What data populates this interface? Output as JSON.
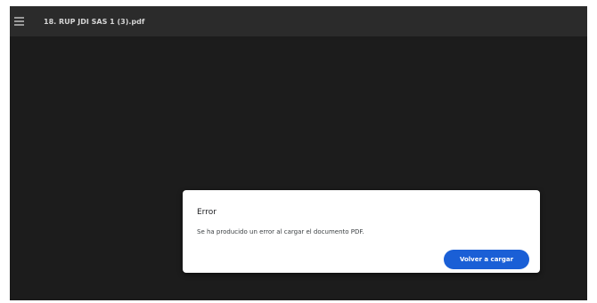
{
  "toolbar": {
    "menu_icon": "menu-icon",
    "title": "18. RUP JDI SAS 1 (3).pdf"
  },
  "dialog": {
    "title": "Error",
    "message": "Se ha producido un error al cargar el documento PDF.",
    "reload_label": "Volver a cargar"
  },
  "colors": {
    "background": "#1c1c1c",
    "toolbar": "#2b2b2b",
    "accent": "#1a5fd6"
  }
}
